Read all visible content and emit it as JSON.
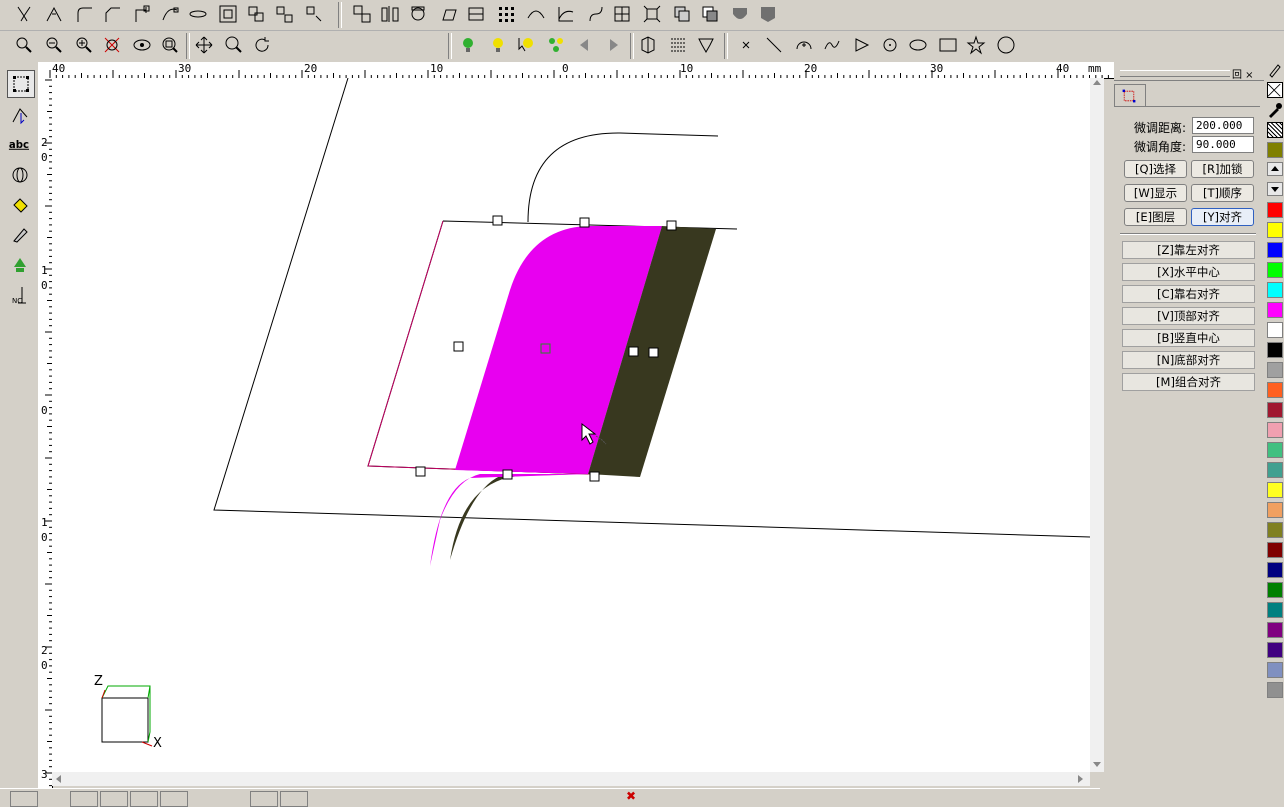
{
  "ruler": {
    "unit": "mm",
    "h_labels": [
      "40",
      "30",
      "20",
      "10",
      "0",
      "10",
      "20",
      "30",
      "40"
    ],
    "v_labels": [
      "2",
      "0",
      "1",
      "0",
      "0",
      "1",
      "0",
      "2",
      "0",
      "3"
    ]
  },
  "panel": {
    "fine_distance_label": "微调距离:",
    "fine_distance_value": "200.000",
    "fine_angle_label": "微调角度:",
    "fine_angle_value": "90.000",
    "buttons": [
      {
        "label": "[Q]选择"
      },
      {
        "label": "[R]加锁"
      },
      {
        "label": "[W]显示"
      },
      {
        "label": "[T]顺序"
      },
      {
        "label": "[E]图层"
      },
      {
        "label": "[Y]对齐"
      }
    ],
    "align_buttons": [
      {
        "label": "[Z]靠左对齐"
      },
      {
        "label": "[X]水平中心"
      },
      {
        "label": "[C]靠右对齐"
      },
      {
        "label": "[V]顶部对齐"
      },
      {
        "label": "[B]竖直中心"
      },
      {
        "label": "[N]底部对齐"
      },
      {
        "label": "[M]组合对齐"
      }
    ],
    "window_controls": "回 ×"
  },
  "axis": {
    "z": "Z",
    "x": "X"
  },
  "palette": [
    "#ff0000",
    "#ffff00",
    "#0000ff",
    "#00ff00",
    "#00ffff",
    "#ff00ff",
    "#ffffff",
    "#000000",
    "#a0a0a0",
    "#ff6020",
    "#a01830",
    "#f0a0b0",
    "#40c080",
    "#40a090",
    "#ffff20",
    "#f0a060",
    "#808020",
    "#800000",
    "#000080",
    "#008000",
    "#008080",
    "#800080",
    "#400080",
    "#8090c0",
    "#909090"
  ],
  "colors": {
    "magenta_face": "#e800f0",
    "dark_face": "#38381f",
    "canvas_bg": "#ffffff"
  }
}
